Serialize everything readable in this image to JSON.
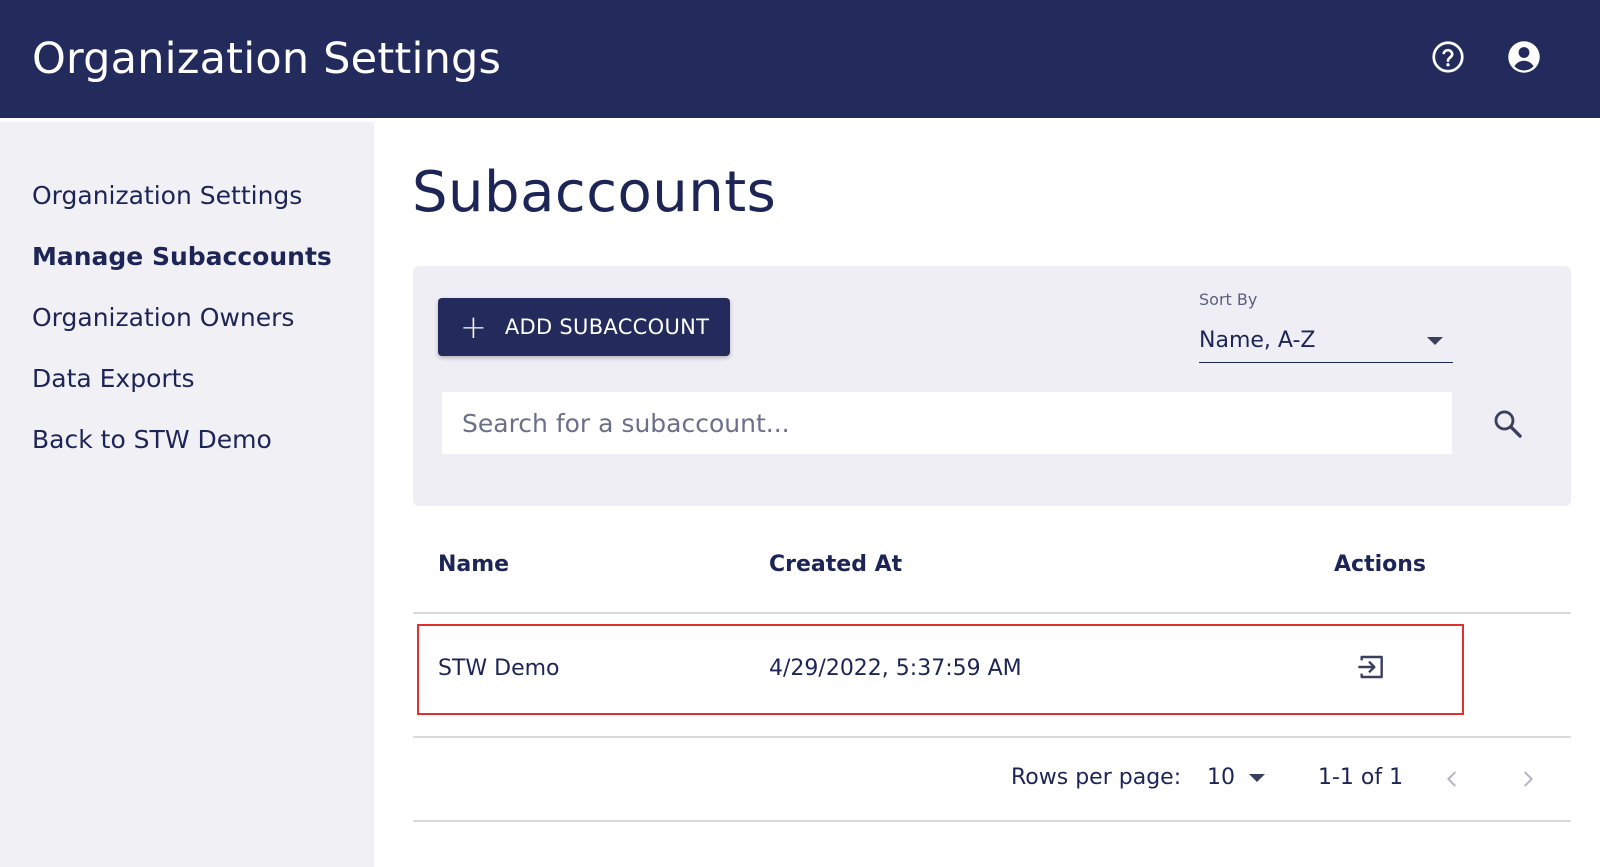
{
  "header": {
    "title": "Organization Settings",
    "help_icon": "help-circle-icon",
    "account_icon": "account-circle-icon"
  },
  "sidebar": {
    "items": [
      {
        "label": "Organization Settings",
        "active": false
      },
      {
        "label": "Manage Subaccounts",
        "active": true
      },
      {
        "label": "Organization Owners",
        "active": false
      },
      {
        "label": "Data Exports",
        "active": false
      },
      {
        "label": "Back to STW Demo",
        "active": false
      }
    ]
  },
  "main": {
    "title": "Subaccounts",
    "add_button": {
      "icon": "plus-icon",
      "label": "ADD SUBACCOUNT"
    },
    "sort": {
      "label": "Sort By",
      "value": "Name, A-Z"
    },
    "search": {
      "placeholder": "Search for a subaccount...",
      "value": ""
    },
    "table": {
      "columns": [
        "Name",
        "Created At",
        "Actions"
      ],
      "rows": [
        {
          "name": "STW Demo",
          "created_at": "4/29/2022, 5:37:59 AM",
          "action_icon": "login-icon"
        }
      ]
    },
    "pagination": {
      "rows_per_page_label": "Rows per page:",
      "rows_per_page": "10",
      "range": "1-1 of 1"
    }
  },
  "colors": {
    "header_bg": "#232a5c",
    "sidebar_bg": "#f0f0f5",
    "controls_bg": "#eeeef4",
    "primary_text": "#1d2556",
    "highlight_border": "#e0302f"
  }
}
